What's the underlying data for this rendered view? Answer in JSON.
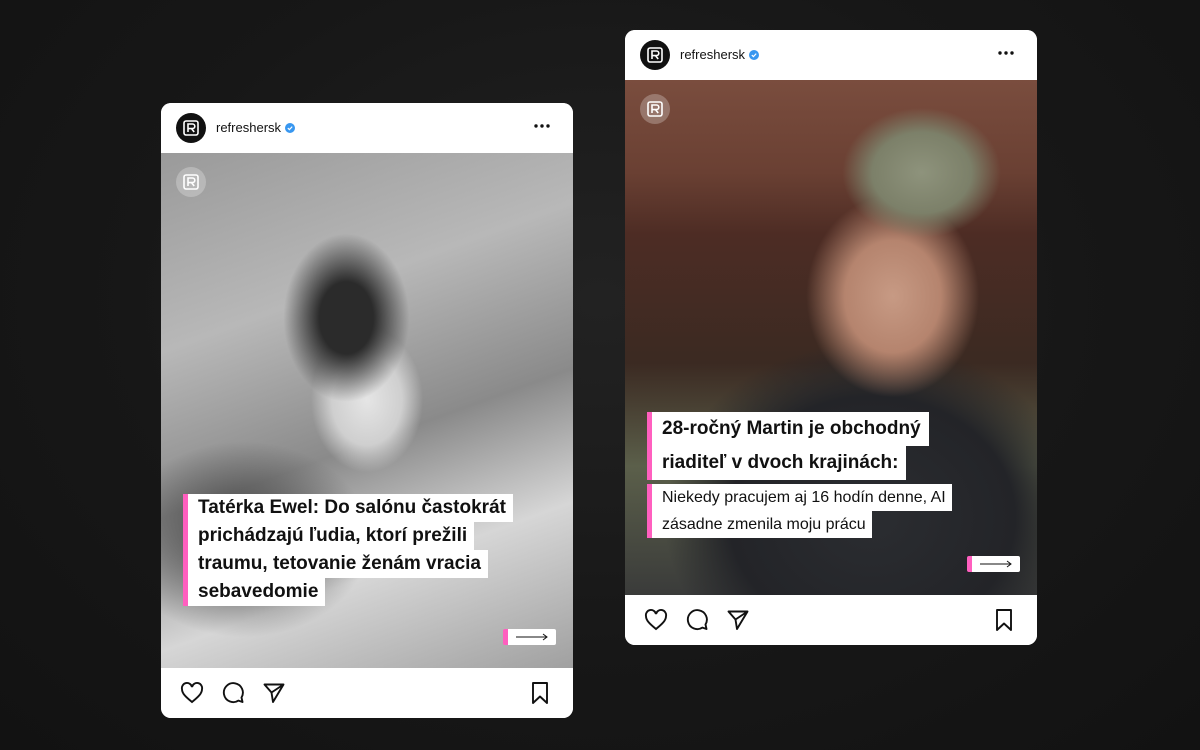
{
  "posts": [
    {
      "username": "refreshersk",
      "caption_lines": [
        "Tatérka Ewel: Do salónu častokrát",
        "prichádzajú ľudia, ktorí prežili",
        "traumu, tetovanie ženám vracia",
        "sebavedomie"
      ],
      "icons": {
        "avatar": "refresher-logo-icon",
        "verified": "verified-badge-icon",
        "more": "more-options-icon",
        "like": "heart-icon",
        "comment": "comment-icon",
        "share": "send-icon",
        "save": "bookmark-icon",
        "arrow": "arrow-right-icon"
      }
    },
    {
      "username": "refreshersk",
      "title_lines": [
        "28-ročný Martin je obchodný",
        "riaditeľ v dvoch krajinách:"
      ],
      "subtitle_lines": [
        "Niekedy pracujem aj 16 hodín denne, AI",
        "zásadne zmenila moju prácu"
      ],
      "icons": {
        "avatar": "refresher-logo-icon",
        "verified": "verified-badge-icon",
        "more": "more-options-icon",
        "like": "heart-icon",
        "comment": "comment-icon",
        "share": "send-icon",
        "save": "bookmark-icon",
        "arrow": "arrow-right-icon"
      }
    }
  ],
  "colors": {
    "accent": "#ff5fbf",
    "verified": "#3897f0",
    "background": "#151515"
  }
}
